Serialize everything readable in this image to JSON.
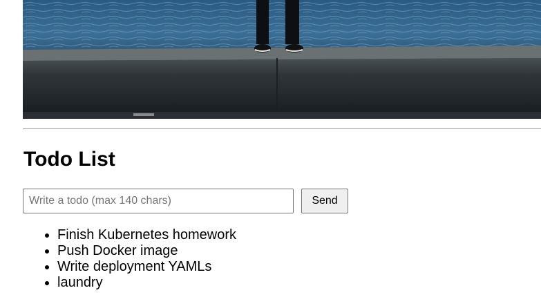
{
  "hero": {
    "image_icon": "photo-of-person-standing-on-seawall"
  },
  "page": {
    "title": "Todo List"
  },
  "form": {
    "input_value": "",
    "input_placeholder": "Write a todo (max 140 chars)",
    "send_label": "Send"
  },
  "todos": {
    "items": [
      {
        "label": "Finish Kubernetes homework"
      },
      {
        "label": "Push Docker image"
      },
      {
        "label": "Write deployment YAMLs"
      },
      {
        "label": "laundry"
      }
    ]
  },
  "colors": {
    "water": "#2f5f86",
    "water_highlight": "#6f9fc0",
    "wall": "#2d3238",
    "wall_top": "#5d6466",
    "button_bg": "#efefef",
    "input_border": "#767676",
    "divider": "#9a9a9a"
  }
}
